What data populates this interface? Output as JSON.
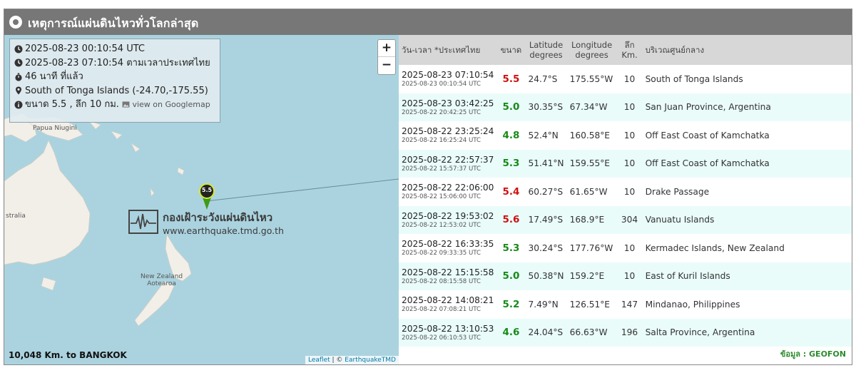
{
  "header": {
    "title": "เหตุการณ์แผ่นดินไหวทั่วโลกล่าสุด"
  },
  "map": {
    "info": {
      "utc_time": "2025-08-23 00:10:54 UTC",
      "thai_time": "2025-08-23 07:10:54 ตามเวลาประเทศไทย",
      "ago": "46 นาที ที่แล้ว",
      "location": "South of Tonga Islands (-24.70,-175.55)",
      "magnitude_depth": "ขนาด 5.5 , ลึก 10 กม.",
      "googlemap_link": "view on Googlemap"
    },
    "zoom_in": "+",
    "zoom_out": "−",
    "labels": {
      "papua": "Papua Niugini",
      "australia": "stralia",
      "nz_line1": "New Zealand",
      "nz_line2": "Aotearoa"
    },
    "watermark": {
      "name": "กองเฝ้าระวังแผ่นดินไหว",
      "url": "www.earthquake.tmd.go.th"
    },
    "marker_label": "5.5",
    "distance": "10,048 Km. to BANGKOK",
    "attribution": {
      "leaflet": "Leaflet",
      "sep": " | © ",
      "provider": "EarthquakeTMD"
    }
  },
  "table": {
    "headers": {
      "datetime": "วัน-เวลา *ประเทศไทย",
      "magnitude": "ขนาด",
      "lat_1": "Latitude",
      "lat_2": "degrees",
      "lon_1": "Longitude",
      "lon_2": "degrees",
      "depth_1": "ลึก",
      "depth_2": "Km.",
      "region": "บริเวณศูนย์กลาง"
    },
    "rows": [
      {
        "thai": "2025-08-23 07:10:54",
        "utc": "2025-08-23 00:10:54 UTC",
        "mag": "5.5",
        "level": "red",
        "lat": "24.7°S",
        "lon": "175.55°W",
        "depth": "10",
        "region": "South of Tonga Islands"
      },
      {
        "thai": "2025-08-23 03:42:25",
        "utc": "2025-08-22 20:42:25 UTC",
        "mag": "5.0",
        "level": "green",
        "lat": "30.35°S",
        "lon": "67.34°W",
        "depth": "10",
        "region": "San Juan Province, Argentina"
      },
      {
        "thai": "2025-08-22 23:25:24",
        "utc": "2025-08-22 16:25:24 UTC",
        "mag": "4.8",
        "level": "green",
        "lat": "52.4°N",
        "lon": "160.58°E",
        "depth": "10",
        "region": "Off East Coast of Kamchatka"
      },
      {
        "thai": "2025-08-22 22:57:37",
        "utc": "2025-08-22 15:57:37 UTC",
        "mag": "5.3",
        "level": "green",
        "lat": "51.41°N",
        "lon": "159.55°E",
        "depth": "10",
        "region": "Off East Coast of Kamchatka"
      },
      {
        "thai": "2025-08-22 22:06:00",
        "utc": "2025-08-22 15:06:00 UTC",
        "mag": "5.4",
        "level": "red",
        "lat": "60.27°S",
        "lon": "61.65°W",
        "depth": "10",
        "region": "Drake Passage"
      },
      {
        "thai": "2025-08-22 19:53:02",
        "utc": "2025-08-22 12:53:02 UTC",
        "mag": "5.6",
        "level": "red",
        "lat": "17.49°S",
        "lon": "168.9°E",
        "depth": "304",
        "region": "Vanuatu Islands"
      },
      {
        "thai": "2025-08-22 16:33:35",
        "utc": "2025-08-22 09:33:35 UTC",
        "mag": "5.3",
        "level": "green",
        "lat": "30.24°S",
        "lon": "177.76°W",
        "depth": "10",
        "region": "Kermadec Islands, New Zealand"
      },
      {
        "thai": "2025-08-22 15:15:58",
        "utc": "2025-08-22 08:15:58 UTC",
        "mag": "5.0",
        "level": "green",
        "lat": "50.38°N",
        "lon": "159.2°E",
        "depth": "10",
        "region": "East of Kuril Islands"
      },
      {
        "thai": "2025-08-22 14:08:21",
        "utc": "2025-08-22 07:08:21 UTC",
        "mag": "5.2",
        "level": "green",
        "lat": "7.49°N",
        "lon": "126.51°E",
        "depth": "147",
        "region": "Mindanao, Philippines"
      },
      {
        "thai": "2025-08-22 13:10:53",
        "utc": "2025-08-22 06:10:53 UTC",
        "mag": "4.6",
        "level": "green",
        "lat": "24.04°S",
        "lon": "66.63°W",
        "depth": "196",
        "region": "Salta Province, Argentina"
      }
    ],
    "source": "ข้อมูล : GEOFON"
  },
  "colors": {
    "red": "#d01010",
    "green": "#178a17",
    "header_bg": "#777777",
    "row_alt": "#e9fcfa",
    "sea": "#abd3df",
    "land": "#f2efe9"
  },
  "icons": {
    "clock": "clock-icon",
    "stopwatch": "stopwatch-icon",
    "pin": "map-pin-icon",
    "info": "info-icon",
    "photo": "image-icon"
  }
}
